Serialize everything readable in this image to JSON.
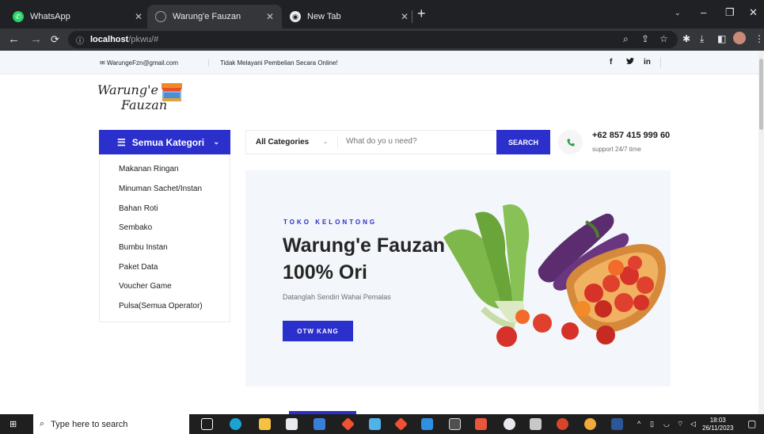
{
  "browser": {
    "tabs": [
      {
        "label": "WhatsApp",
        "icon": "whatsapp-icon",
        "active": false
      },
      {
        "label": "Warung'e Fauzan",
        "icon": "globe-icon",
        "active": true
      },
      {
        "label": "New Tab",
        "icon": "chrome-icon",
        "active": false
      }
    ],
    "url_host": "localhost",
    "url_path": "/pkwu/#"
  },
  "topbar": {
    "email": "WarungeFzn@gmail.com",
    "notice": "Tidak Melayani Pembelian Secara Online!",
    "social": [
      "f",
      "in"
    ]
  },
  "logo": {
    "line1": "Warung'e",
    "line2": "Fauzan"
  },
  "categories": {
    "title": "Semua Kategori",
    "items": [
      "Makanan Ringan",
      "Minuman Sachet/Instan",
      "Bahan Roti",
      "Sembako",
      "Bumbu Instan",
      "Paket Data",
      "Voucher Game",
      "Pulsa(Semua Operator)"
    ]
  },
  "search": {
    "category": "All Categories",
    "placeholder": "What do yo u need?",
    "button": "SEARCH"
  },
  "contact": {
    "phone": "+62 857 415 999 60",
    "support": "support 24/7 time"
  },
  "hero": {
    "eyebrow": "TOKO KELONTONG",
    "title_line1": "Warung'e Fauzan",
    "title_line2": "100% Ori",
    "description": "Datanglah Sendiri Wahai Pemalas",
    "cta": "OTW KANG"
  },
  "taskbar": {
    "search_placeholder": "Type here to search",
    "time": "18:03",
    "date": "26/11/2023"
  },
  "colors": {
    "accent": "#2b2fcb",
    "whatsapp": "#25d366"
  }
}
